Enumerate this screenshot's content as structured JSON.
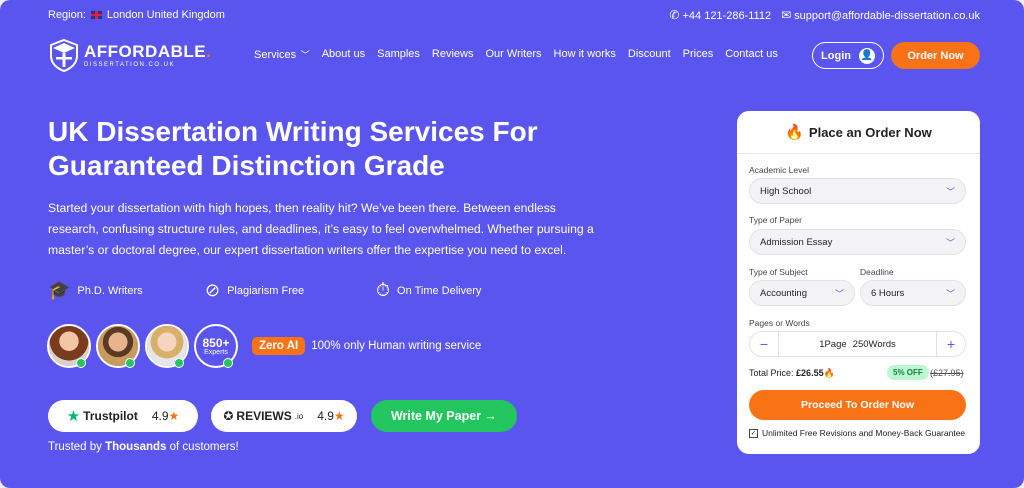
{
  "topbar": {
    "region_label": "Region:",
    "region_value": "London United Kingdom",
    "phone": "+44 121-286-1112",
    "email": "support@affordable-dissertation.co.uk"
  },
  "logo": {
    "main": "AFFORDABLE",
    "sub": "DISSERTATION.CO.UK"
  },
  "nav": {
    "items": [
      "Services",
      "About us",
      "Samples",
      "Reviews",
      "Our Writers",
      "How it works",
      "Discount",
      "Prices",
      "Contact us"
    ],
    "login": "Login",
    "order_now": "Order Now"
  },
  "hero": {
    "title_line1": "UK Dissertation Writing Services For",
    "title_line2": "Guaranteed Distinction Grade",
    "description": "Started your dissertation with high hopes, then reality hit? We’ve been there. Between endless research, confusing structure rules, and deadlines, it’s easy to feel overwhelmed.  Whether pursuing a master’s or doctoral degree, our expert dissertation writers offer the expertise you need to excel.",
    "features": [
      "Ph.D. Writers",
      "Plagiarism Free",
      "On Time Delivery"
    ],
    "experts_count": "850+",
    "experts_label": "Experts",
    "zero_ai_badge": "Zero AI",
    "zero_ai_text": "100% only Human writing service",
    "trustpilot": {
      "name": "Trustpilot",
      "rating": "4.9"
    },
    "reviews_io": {
      "name": "REVIEWS",
      "suffix": ".io",
      "rating": "4.9"
    },
    "write_button": "Write My Paper →",
    "trusted_prefix": "Trusted by ",
    "trusted_bold": "Thousands",
    "trusted_suffix": " of customers!"
  },
  "order_form": {
    "title": "Place an Order Now",
    "academic_level_label": "Academic Level",
    "academic_level_value": "High School",
    "paper_type_label": "Type of Paper",
    "paper_type_value": "Admission Essay",
    "subject_label": "Type of Subject",
    "subject_value": "Accounting",
    "deadline_label": "Deadline",
    "deadline_value": "6 Hours",
    "pages_label": "Pages or Words",
    "pages_value": "1Page",
    "words_value": "250Words",
    "total_label": "Total Price:",
    "total_value": "£26.55",
    "discount_badge": "5% OFF",
    "old_price": "(£27.95)",
    "proceed_button": "Proceed To Order Now",
    "guarantee": "Unlimited Free Revisions and Money-Back Guarantee"
  },
  "colors": {
    "primary": "#5b55f0",
    "accent": "#f97316",
    "success": "#22c55e"
  }
}
